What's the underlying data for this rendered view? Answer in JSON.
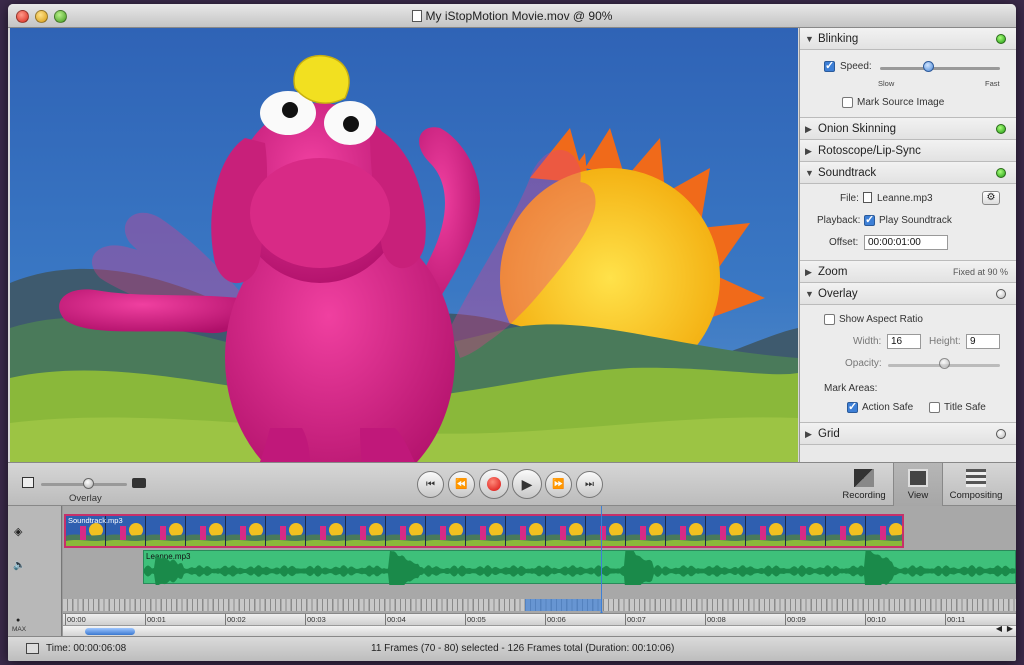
{
  "window": {
    "title": "My iStopMotion Movie.mov @ 90%"
  },
  "inspector": {
    "blinking": {
      "title": "Blinking",
      "speed_label": "Speed:",
      "slow_label": "Slow",
      "fast_label": "Fast",
      "speed_value": 0.4,
      "mark_source_label": "Mark Source Image"
    },
    "onion_skinning": {
      "title": "Onion Skinning"
    },
    "rotoscope": {
      "title": "Rotoscope/Lip-Sync"
    },
    "soundtrack": {
      "title": "Soundtrack",
      "file_label": "File:",
      "file_name": "Leanne.mp3",
      "playback_label": "Playback:",
      "play_soundtrack_label": "Play Soundtrack",
      "offset_label": "Offset:",
      "offset_value": "00:00:01:00"
    },
    "zoom": {
      "title": "Zoom",
      "note": "Fixed at 90 %"
    },
    "overlay": {
      "title": "Overlay",
      "show_aspect_label": "Show Aspect Ratio",
      "width_label": "Width:",
      "width_value": "16",
      "height_label": "Height:",
      "height_value": "9",
      "opacity_label": "Opacity:",
      "opacity_value": 0.5,
      "mark_areas_label": "Mark Areas:",
      "action_safe_label": "Action Safe",
      "title_safe_label": "Title Safe"
    },
    "grid": {
      "title": "Grid"
    }
  },
  "toolbar": {
    "overlay_label": "Overlay",
    "overlay_value": 0.55,
    "recording_label": "Recording",
    "view_label": "View",
    "compositing_label": "Compositing"
  },
  "timeline": {
    "video_track_label": "Soundtrack.mp3",
    "audio_track_label": "Leanne.mp3",
    "max_label": "MAX",
    "ticks": [
      "00:00",
      "00:01",
      "00:02",
      "00:03",
      "00:04",
      "00:05",
      "00:06",
      "00:07",
      "00:08",
      "00:09",
      "00:10",
      "00:11"
    ]
  },
  "status": {
    "time_label": "Time: 00:00:06:08",
    "frames_info": "11 Frames (70 - 80) selected - 126 Frames total (Duration: 00:10:06)"
  },
  "colors": {
    "selection_blue": "#3d7fd6",
    "led_green": "#1f9a12",
    "audio_green": "#3ec07a",
    "video_border": "#c8306a"
  }
}
